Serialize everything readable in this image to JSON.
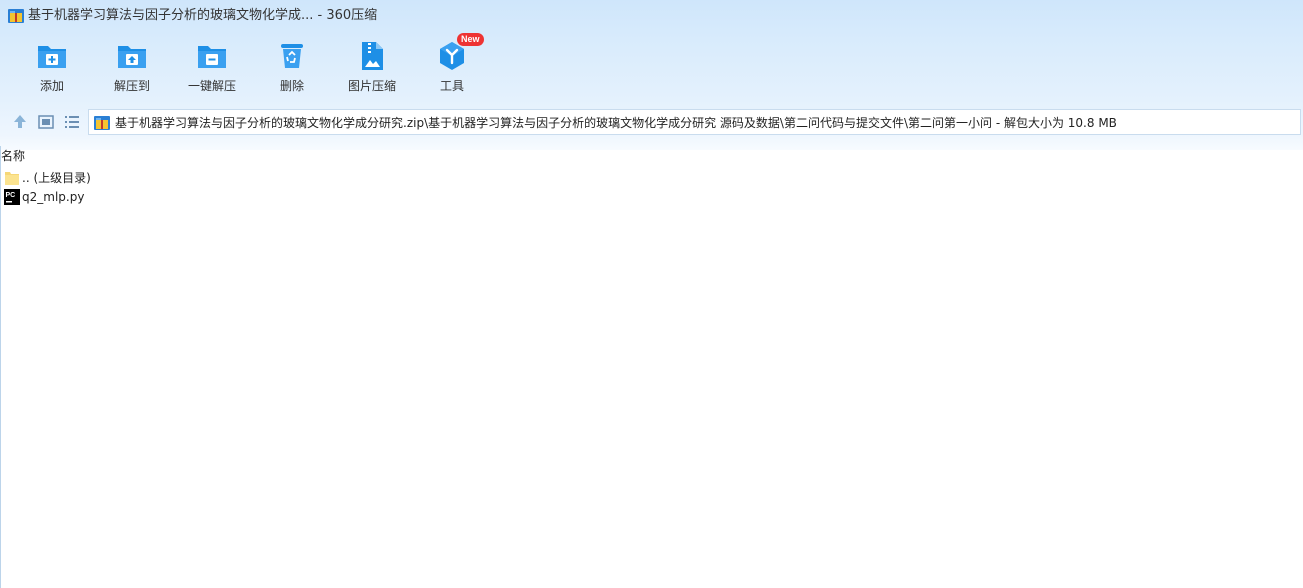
{
  "window": {
    "title": "基于机器学习算法与因子分析的玻璃文物化学成... - 360压缩"
  },
  "toolbar": {
    "items": [
      {
        "label": "添加",
        "icon": "add-folder-icon"
      },
      {
        "label": "解压到",
        "icon": "extract-to-icon"
      },
      {
        "label": "一键解压",
        "icon": "one-click-extract-icon"
      },
      {
        "label": "删除",
        "icon": "recycle-bin-icon"
      },
      {
        "label": "图片压缩",
        "icon": "image-compress-icon"
      },
      {
        "label": "工具",
        "icon": "tools-icon",
        "badge": "New"
      }
    ]
  },
  "nav": {
    "up_icon": "arrow-up-icon",
    "thumbnail_icon": "thumbnail-view-icon",
    "list_icon": "list-view-icon",
    "address": "基于机器学习算法与因子分析的玻璃文物化学成分研究.zip\\基于机器学习算法与因子分析的玻璃文物化学成分研究 源码及数据\\第二问代码与提交文件\\第二问第一小问 - 解包大小为 10.8 MB"
  },
  "list": {
    "column_name": "名称",
    "rows": [
      {
        "name": ".. (上级目录)",
        "icon": "folder-icon"
      },
      {
        "name": "q2_mlp.py",
        "icon": "pycharm-file-icon"
      }
    ]
  },
  "colors": {
    "accent": "#1e8fe6",
    "badge": "#ee3333"
  }
}
